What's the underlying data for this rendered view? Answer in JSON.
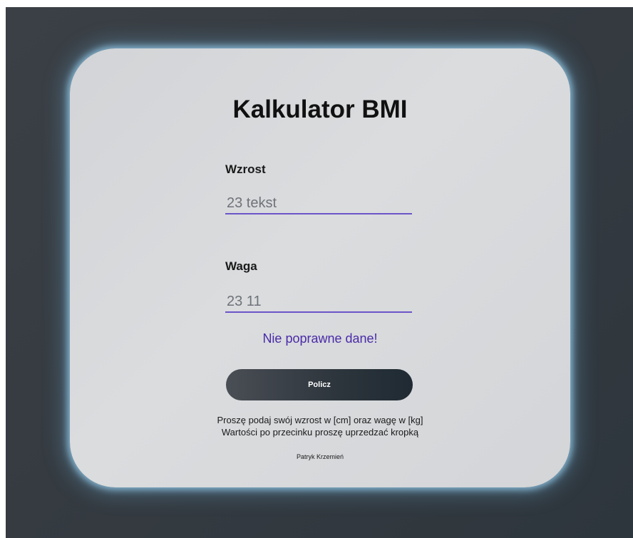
{
  "page": {
    "title": "Kalkulator BMI"
  },
  "form": {
    "height_label": "Wzrost",
    "height_value": "23 tekst",
    "weight_label": "Waga",
    "weight_value": "23 11",
    "error_message": "Nie poprawne dane!",
    "submit_label": "Policz"
  },
  "info": {
    "line1": "Proszę podaj swój wzrost w [cm] oraz wagę w [kg]",
    "line2": "Wartości po przecinku proszę uprzedzać kropką"
  },
  "footer": {
    "author": "Patryk Krzemień"
  },
  "colors": {
    "accent": "#6c55c8",
    "error": "#4a2aa8",
    "background": "#353b41",
    "card": "#d7d9dc",
    "glow": "#96cdeb"
  }
}
